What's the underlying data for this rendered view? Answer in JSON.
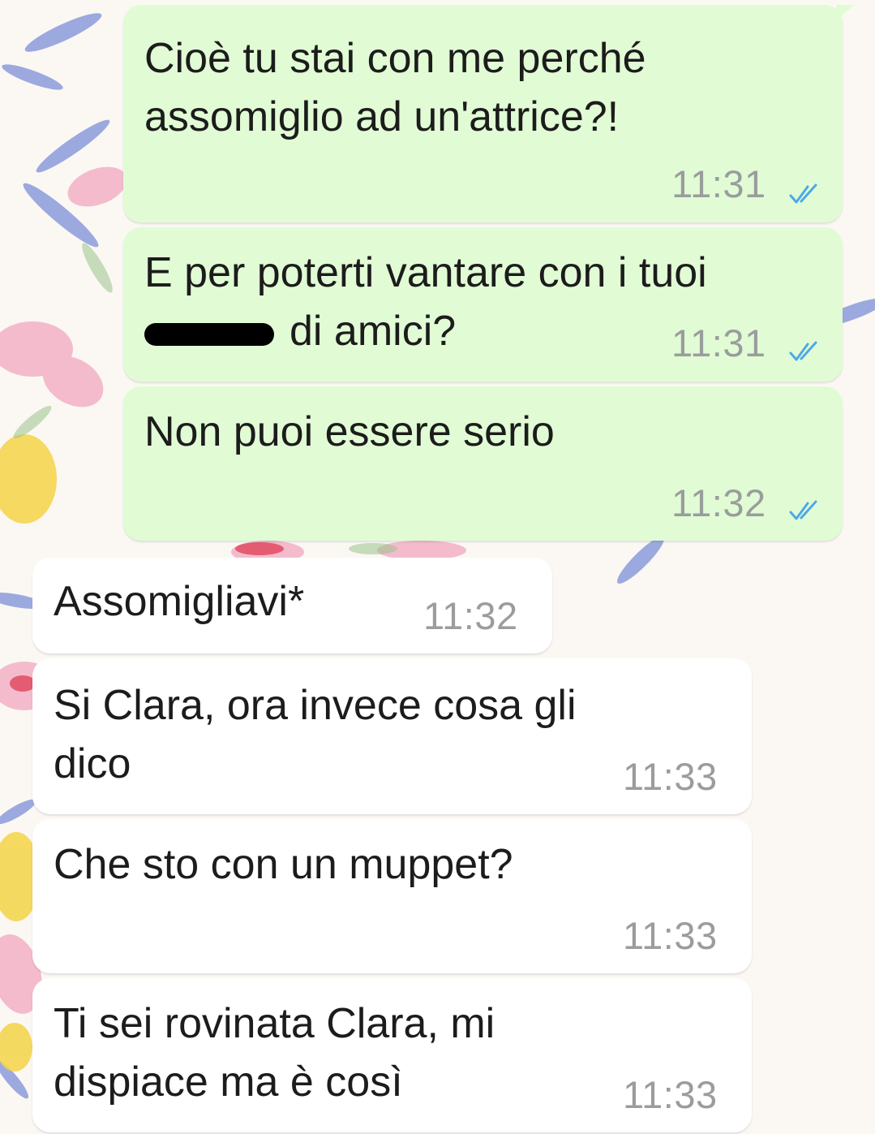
{
  "messages": [
    {
      "direction": "outgoing",
      "lines": [
        "Cioè tu stai con me perché",
        "assomiglio ad un'attrice?!"
      ],
      "time": "11:31",
      "status": "read-double-check"
    },
    {
      "direction": "outgoing",
      "lines": [
        "E per poterti vantare con i tuoi",
        "di amici?"
      ],
      "redacted_word_before_line_2": true,
      "time": "11:31",
      "status": "read-double-check"
    },
    {
      "direction": "outgoing",
      "lines": [
        "Non puoi essere serio"
      ],
      "time": "11:32",
      "status": "read-double-check"
    },
    {
      "direction": "incoming",
      "lines": [
        "Assomigliavi*"
      ],
      "time": "11:32"
    },
    {
      "direction": "incoming",
      "lines": [
        "Si Clara, ora invece cosa gli",
        "dico"
      ],
      "time": "11:33"
    },
    {
      "direction": "incoming",
      "lines": [
        "Che sto con un muppet?"
      ],
      "time": "11:33"
    },
    {
      "direction": "incoming",
      "lines": [
        "Ti sei rovinata Clara, mi",
        "dispiace ma è così"
      ],
      "time": "11:33"
    }
  ],
  "colors": {
    "outgoing_bubble": "#e1fcd5",
    "incoming_bubble": "#ffffff",
    "read_ticks": "#4fa8e8",
    "timestamp": "#9a9d9c",
    "text": "#1c1c1c"
  },
  "icons": [
    "double-check-read-icon"
  ]
}
